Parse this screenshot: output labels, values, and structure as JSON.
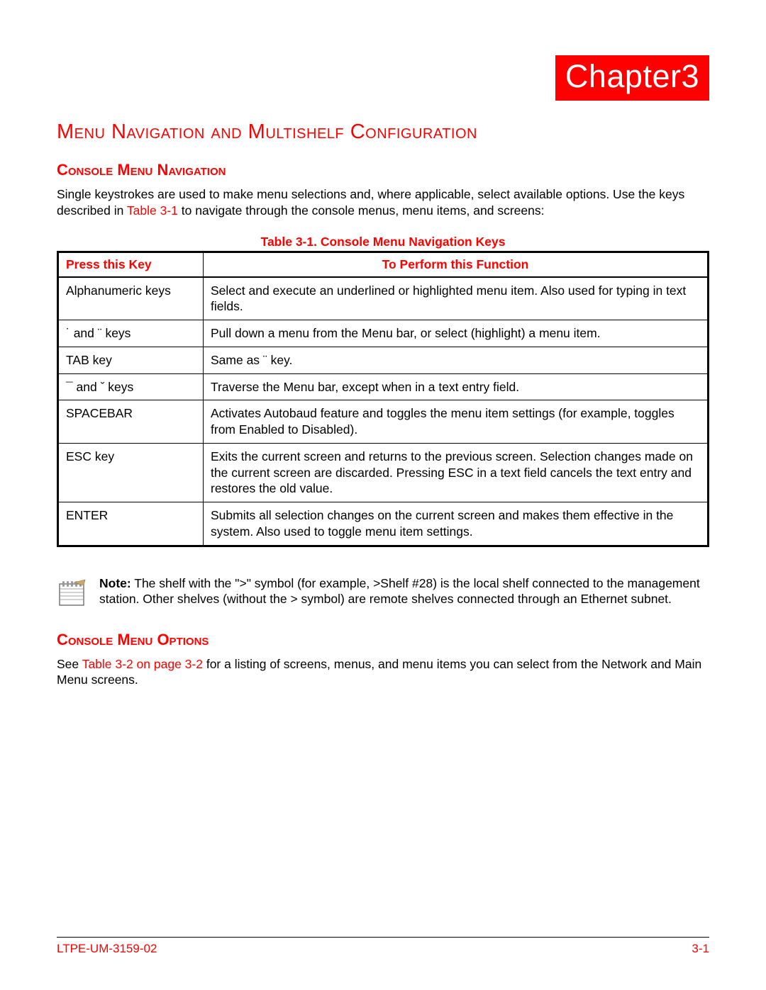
{
  "chapter_label": "Chapter3",
  "main_title": "Menu Navigation and Multishelf Configuration",
  "section1": {
    "title": "Console Menu Navigation",
    "intro_pre": "Single keystrokes are used to make menu selections and, where applicable, select available options. Use the keys described in ",
    "intro_link": "Table 3-1",
    "intro_post": " to navigate through the console menus, menu items, and screens:"
  },
  "table": {
    "caption": "Table 3-1. Console Menu Navigation Keys",
    "col1": "Press this Key",
    "col2": "To Perform this Function",
    "rows": [
      {
        "key": "Alphanumeric keys",
        "func": "Select and execute an underlined or highlighted menu item. Also used for typing in text fields."
      },
      {
        "key": "˙ and ¨ keys",
        "func": "Pull down a menu from the Menu bar, or select (highlight) a menu item."
      },
      {
        "key": "TAB key",
        "func": "Same as ¨ key."
      },
      {
        "key": "¯ and ˇ keys",
        "func": "Traverse the Menu bar, except when in a text entry field."
      },
      {
        "key": "SPACEBAR",
        "func": "Activates Autobaud feature and toggles the menu item settings (for example, toggles from Enabled to Disabled)."
      },
      {
        "key": "ESC key",
        "func": "Exits the current screen and returns to the previous screen. Selection changes made on the current screen are discarded. Pressing ESC in a text field cancels the text entry and restores the old value."
      },
      {
        "key": "ENTER",
        "func": "Submits all selection changes on the current screen and makes them effective in the system. Also used to toggle menu item settings."
      }
    ]
  },
  "note": {
    "label": "Note:",
    "text": " The shelf with the \">\" symbol (for example, >Shelf #28) is the local shelf connected to the management station. Other shelves (without the > symbol) are remote shelves connected through an Ethernet subnet."
  },
  "section2": {
    "title": "Console Menu Options",
    "intro_pre": "See ",
    "intro_link": "Table 3-2 on page 3-2",
    "intro_post": " for a listing of screens, menus, and menu items you can select from the Network and Main Menu screens."
  },
  "footer": {
    "left": "LTPE-UM-3159-02",
    "right": "3-1"
  }
}
